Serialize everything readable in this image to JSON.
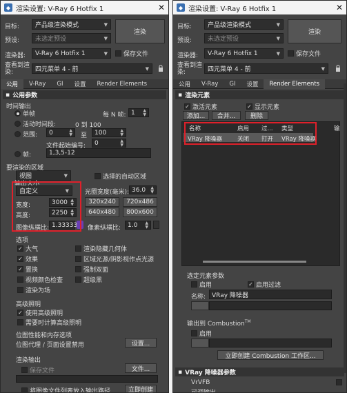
{
  "left": {
    "title": "渲染设置: V-Ray 6 Hotfix 1",
    "target_label": "目标:",
    "target_value": "产品级渲染模式",
    "preset_label": "预设:",
    "preset_value": "未选定预设",
    "renderer_label": "渲染器:",
    "renderer_value": "V-Ray 6 Hotfix 1",
    "save_file_label": "保存文件",
    "view_label_1": "查看到渲",
    "view_label_2": "染:",
    "view_value": "四元菜单 4 - 前",
    "render_button": "渲染",
    "tabs": [
      "公用",
      "V-Ray",
      "GI",
      "设置",
      "Render Elements"
    ],
    "rollout_common": "公用参数",
    "time_output": "时间输出",
    "single_label": "单帧",
    "every_n_label": "每 N 帧:",
    "every_n_value": "1",
    "active_segment_label": "活动时间段:",
    "active_segment_value": "0 到 100",
    "range_label": "范围:",
    "range_from": "0",
    "range_to_label": "至",
    "range_to": "100",
    "file_number_label": "文件起始编号:",
    "file_number_value": "0",
    "frames_label": "帧:",
    "frames_value": "1,3,5-12",
    "render_area_label": "要渲染的区域",
    "render_area_value": "视图",
    "auto_region_label": "选择的自动区域",
    "output_size_label": "输出大小",
    "output_size_value": "自定义",
    "aperture_label": "光圈宽度(毫米):",
    "aperture_value": "36.0",
    "width_label": "宽度:",
    "width_value": "3000",
    "height_label": "高度:",
    "height_value": "2250",
    "presets": [
      "320x240",
      "720x486",
      "640x480",
      "800x600"
    ],
    "aspect_label": "图像纵横比:",
    "aspect_value": "1.33333",
    "pixel_aspect_label": "像素纵横比:",
    "pixel_aspect_value": "1.0",
    "options_label": "选项",
    "options": [
      {
        "label": "大气",
        "checked": true
      },
      {
        "label": "渲染隐藏几何体",
        "checked": false
      },
      {
        "label": "效果",
        "checked": true
      },
      {
        "label": "区域光源/阴影视作点光源",
        "checked": false
      },
      {
        "label": "置换",
        "checked": true
      },
      {
        "label": "强制双面",
        "checked": false
      },
      {
        "label": "视频颜色检查",
        "checked": false
      },
      {
        "label": "超级黑",
        "checked": false
      },
      {
        "label": "渲染为场",
        "checked": false
      }
    ],
    "advanced_light_label": "高级照明",
    "use_advanced_light": "使用高级照明",
    "calc_advanced_light": "需要时计算高级照明",
    "bitmap_perf_label": "位图性能和内存选项",
    "bitmap_proxy_label": "位图代理 / 页面设置禁用",
    "settings_button": "设置...",
    "render_output_label": "渲染输出",
    "save_file_label2": "保存文件",
    "files_button": "文件...",
    "add_to_list_label": "将图像文件列表放入输出路径",
    "create_now_button": "立即创建"
  },
  "right": {
    "title": "渲染设置: V-Ray 6 Hotfix 1",
    "target_label": "目标:",
    "target_value": "产品级渲染模式",
    "preset_label": "预设:",
    "preset_value": "未选定预设",
    "renderer_label": "渲染器:",
    "renderer_value": "V-Ray 6 Hotfix 1",
    "save_file_label": "保存文件",
    "view_label_1": "查看到渲",
    "view_label_2": "染:",
    "view_value": "四元菜单 4 - 前",
    "render_button": "渲染",
    "tabs": [
      "公用",
      "V-Ray",
      "GI",
      "设置",
      "Render Elements"
    ],
    "rollout_elements": "渲染元素",
    "activate_elements": "激活元素",
    "show_elements": "显示元素",
    "add_button": "添加...",
    "merge_button": "合并...",
    "delete_button": "删除",
    "table_headers": [
      "名称",
      "启用",
      "过...",
      "类型",
      "输"
    ],
    "table_row": [
      "VRay 降噪器",
      "关闭",
      "打开",
      "VRay 降噪器"
    ],
    "selected_params_label": "选定元素参数",
    "enable_label": "启用",
    "enable_filter_label": "启用过滤",
    "name_label": "名称:",
    "name_value": "VRay 降噪器",
    "output_combustion_label": "输出到 Combustion",
    "combustion_tm": "TM",
    "combustion_enable": "启用",
    "create_combustion_button": "立即创建 Combustion 工作区...",
    "rollout_denoiser": "VRay 降噪器参数",
    "vfb_label": "VrVFB",
    "denoise_label": "可调输出"
  },
  "colors": {
    "highlight_box": "#e0202a",
    "panel_bg": "#444444",
    "field_bg": "#2a2a2a"
  }
}
